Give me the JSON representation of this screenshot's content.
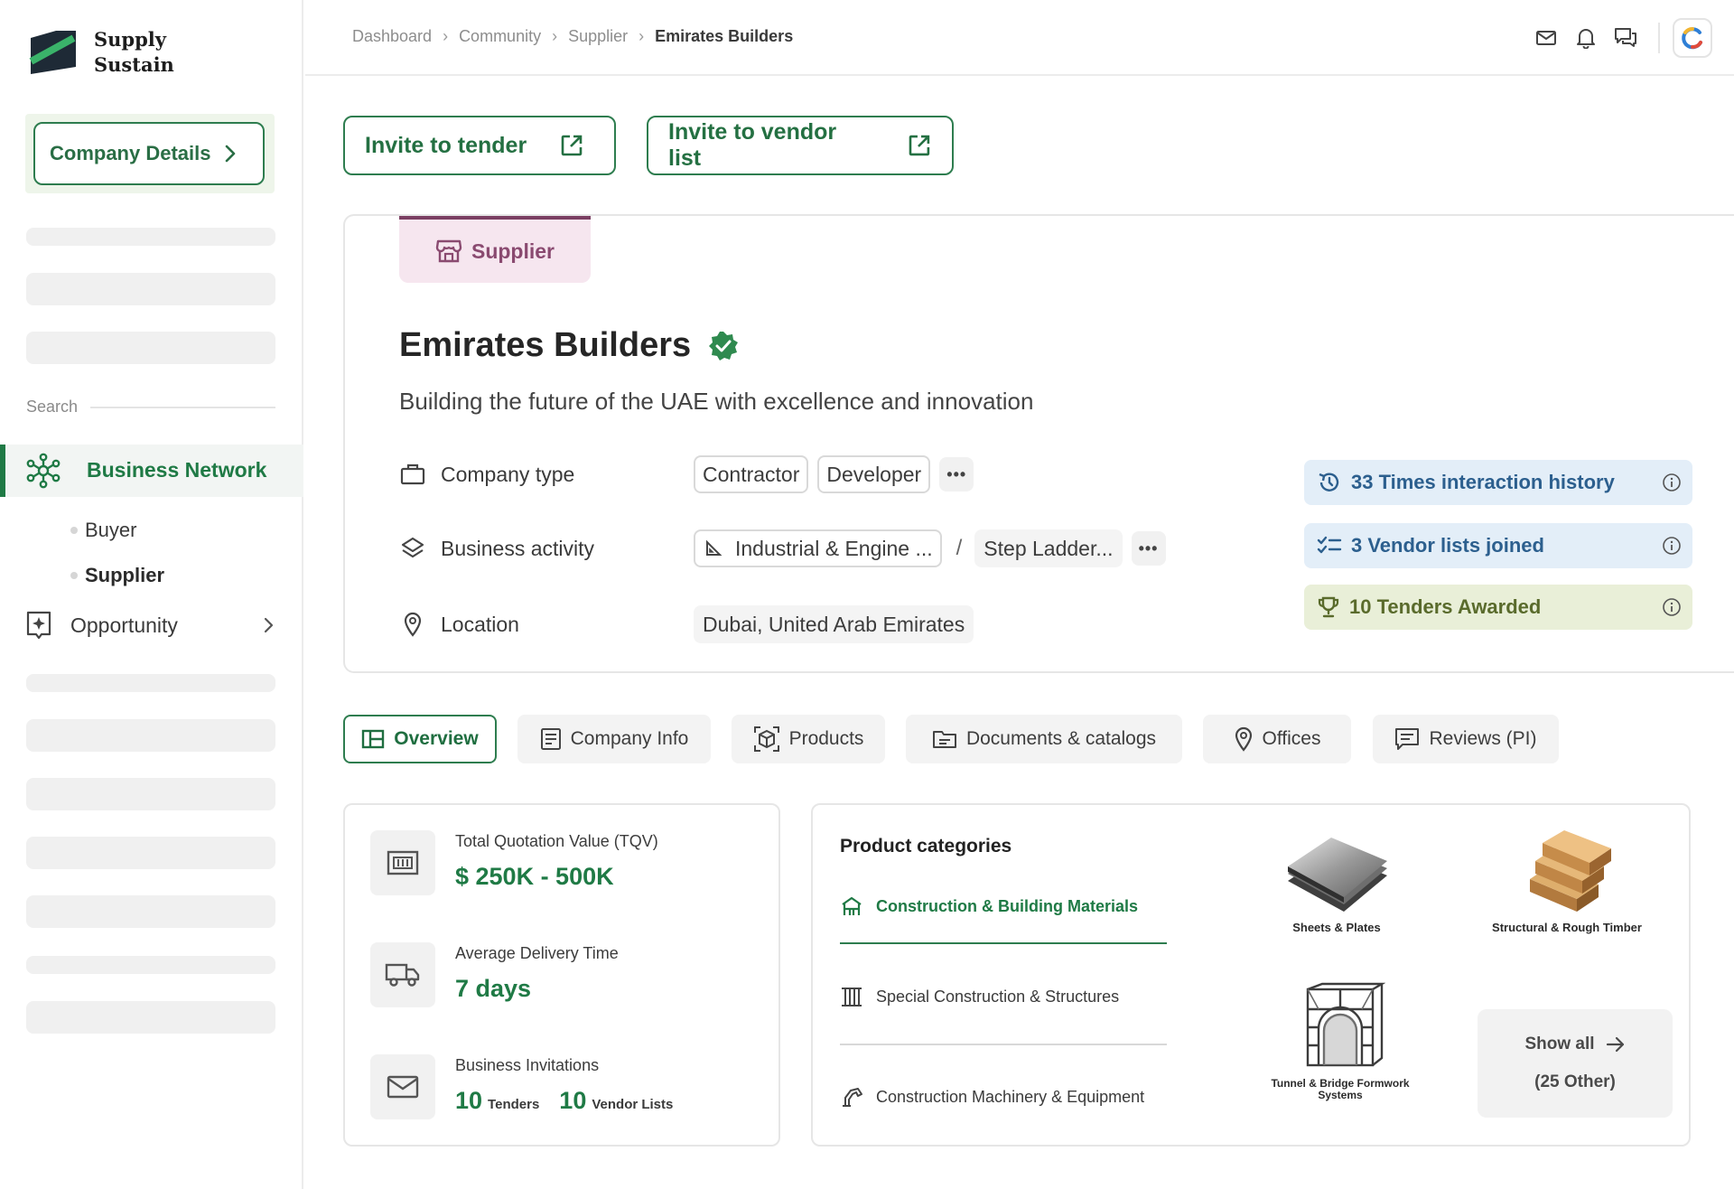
{
  "brand": {
    "line1": "Supply",
    "line2": "Sustain"
  },
  "sidebar": {
    "company_details": "Company Details",
    "search_label": "Search",
    "active_item": "Business Network",
    "sub_items": [
      "Buyer",
      "Supplier"
    ],
    "opportunity": "Opportunity"
  },
  "breadcrumb": [
    "Dashboard",
    "Community",
    "Supplier",
    "Emirates Builders"
  ],
  "actions": {
    "invite_tender": "Invite to tender",
    "invite_vendor": "Invite to vendor list"
  },
  "profile": {
    "role_tag": "Supplier",
    "name": "Emirates Builders",
    "tagline": "Building the future of the UAE with excellence and innovation",
    "company_type_label": "Company type",
    "company_types": [
      "Contractor",
      "Developer"
    ],
    "business_activity_label": "Business activity",
    "business_activity": "Industrial & Engine ...",
    "business_activity_sub": "Step Ladder...",
    "location_label": "Location",
    "location": "Dubai, United Arab Emirates",
    "more": "•••"
  },
  "stats": [
    {
      "text": "33 Times interaction history",
      "bg": "#e3eef8",
      "color": "#2c5f8e",
      "icon": "history-icon"
    },
    {
      "text": "3 Vendor lists joined",
      "bg": "#e3eef8",
      "color": "#2c5f8e",
      "icon": "checklist-icon"
    },
    {
      "text": "10 Tenders Awarded",
      "bg": "#e9efd8",
      "color": "#5a6b2c",
      "icon": "trophy-icon"
    }
  ],
  "tabs": [
    "Overview",
    "Company Info",
    "Products",
    "Documents & catalogs",
    "Offices",
    "Reviews (PI)"
  ],
  "metrics": {
    "tqv_label": "Total Quotation Value (TQV)",
    "tqv_value": "$ 250K - 500K",
    "delivery_label": "Average Delivery Time",
    "delivery_value": "7 days",
    "invitations_label": "Business Invitations",
    "tenders_count": "10",
    "tenders_unit": "Tenders",
    "vendor_count": "10",
    "vendor_unit": "Vendor Lists"
  },
  "product_categories": {
    "title": "Product categories",
    "categories": [
      "Construction & Building Materials",
      "Special Construction & Structures",
      "Construction Machinery & Equipment"
    ],
    "products": [
      "Sheets & Plates",
      "Structural & Rough Timber",
      "Tunnel & Bridge Formwork Systems"
    ],
    "show_all": "Show all",
    "others": "(25 Other)"
  },
  "colors": {
    "accent": "#1f7a45",
    "supplier_tag": "#8a4a70"
  }
}
